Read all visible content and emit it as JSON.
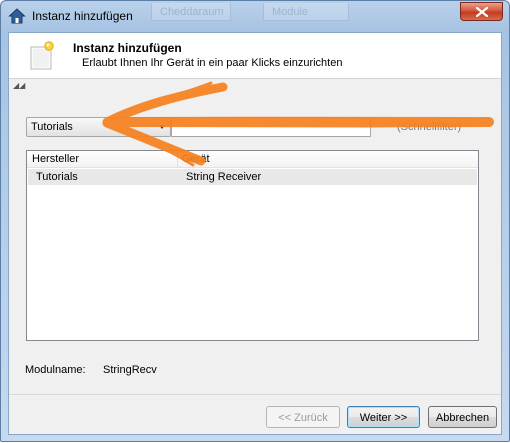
{
  "window": {
    "title": "Instanz hinzufügen",
    "background_tabs": [
      "Cheddaraum",
      "Module"
    ]
  },
  "header": {
    "title": "Instanz hinzufügen",
    "subtitle": "Erlaubt Ihnen Ihr Gerät in ein paar Klicks einzurichten"
  },
  "filter": {
    "category_selected": "Tutorials",
    "search_value": "",
    "search_placeholder": "(Schnellfilter)"
  },
  "device_list": {
    "columns": [
      "Hersteller",
      "Gerät"
    ],
    "rows": [
      {
        "manufacturer": "Tutorials",
        "device": "String Receiver"
      }
    ]
  },
  "module": {
    "label": "Modulname:",
    "value": "StringRecv"
  },
  "buttons": {
    "back": "<< Zurück",
    "next": "Weiter >>",
    "cancel": "Abbrechen"
  },
  "colors": {
    "annotation_arrow": "#f7801e",
    "selected_row": "#e8e8e8",
    "close_button": "#c94a2c"
  }
}
